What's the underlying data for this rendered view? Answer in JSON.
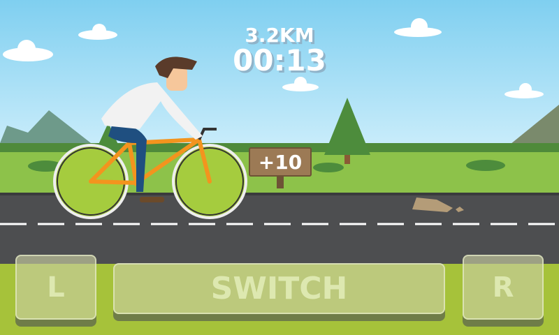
{
  "hud": {
    "distance": "3.2KM",
    "time": "00:13"
  },
  "sign": {
    "bonus": "+10"
  },
  "controls": {
    "left_label": "L",
    "switch_label": "SWITCH",
    "right_label": "R"
  },
  "colors": {
    "sky_top": "#7fcff0",
    "sky_bottom": "#c8ecfa",
    "grass": "#a6c23a",
    "road": "#4d4e50",
    "bike": "#f3941e"
  }
}
